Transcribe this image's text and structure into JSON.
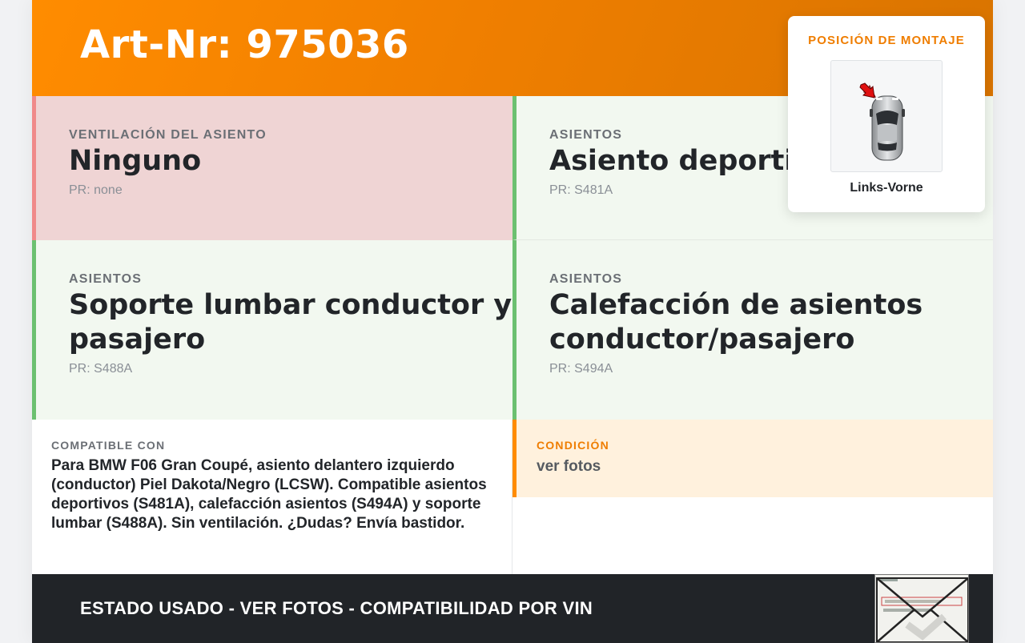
{
  "header": {
    "art_nr": "Art-Nr: 975036"
  },
  "features": [
    {
      "key": "VENTILACIÓN DEL ASIENTO",
      "value": "Ninguno",
      "pr": "PR: none"
    },
    {
      "key": "ASIENTOS",
      "value": "Asiento deportivo",
      "pr": "PR: S481A"
    },
    {
      "key": "ASIENTOS",
      "value": "Soporte lumbar conductor y pasajero",
      "pr": "PR: S488A"
    },
    {
      "key": "ASIENTOS",
      "value": "Calefacción de asientos conductor/pasajero",
      "pr": "PR: S494A"
    }
  ],
  "compatible": {
    "label": "COMPATIBLE CON",
    "text": "Para BMW F06 Gran Coupé, asiento delantero izquierdo (conductor) Piel Dakota/Negro (LCSW). Compatible asientos deportivos (S481A), calefacción asientos (S494A) y soporte lumbar (S488A). Sin ventilación. ¿Dudas? Envía bastidor."
  },
  "condition": {
    "label": "CONDICIÓN",
    "text": "ver fotos"
  },
  "footer": {
    "text": "ESTADO USADO - VER FOTOS - COMPATIBILIDAD POR VIN"
  },
  "mount": {
    "label": "POSICIÓN DE MONTAJE",
    "caption": "Links-Vorne"
  },
  "colors": {
    "accent": "#ff8c00",
    "dark": "#212428",
    "negative_bg": "#efd4d4",
    "positive_bg": "#f2f8f0"
  },
  "icons": {
    "mount_diagram": "car-top-view-icon",
    "position_marker": "red-arrow-icon"
  }
}
